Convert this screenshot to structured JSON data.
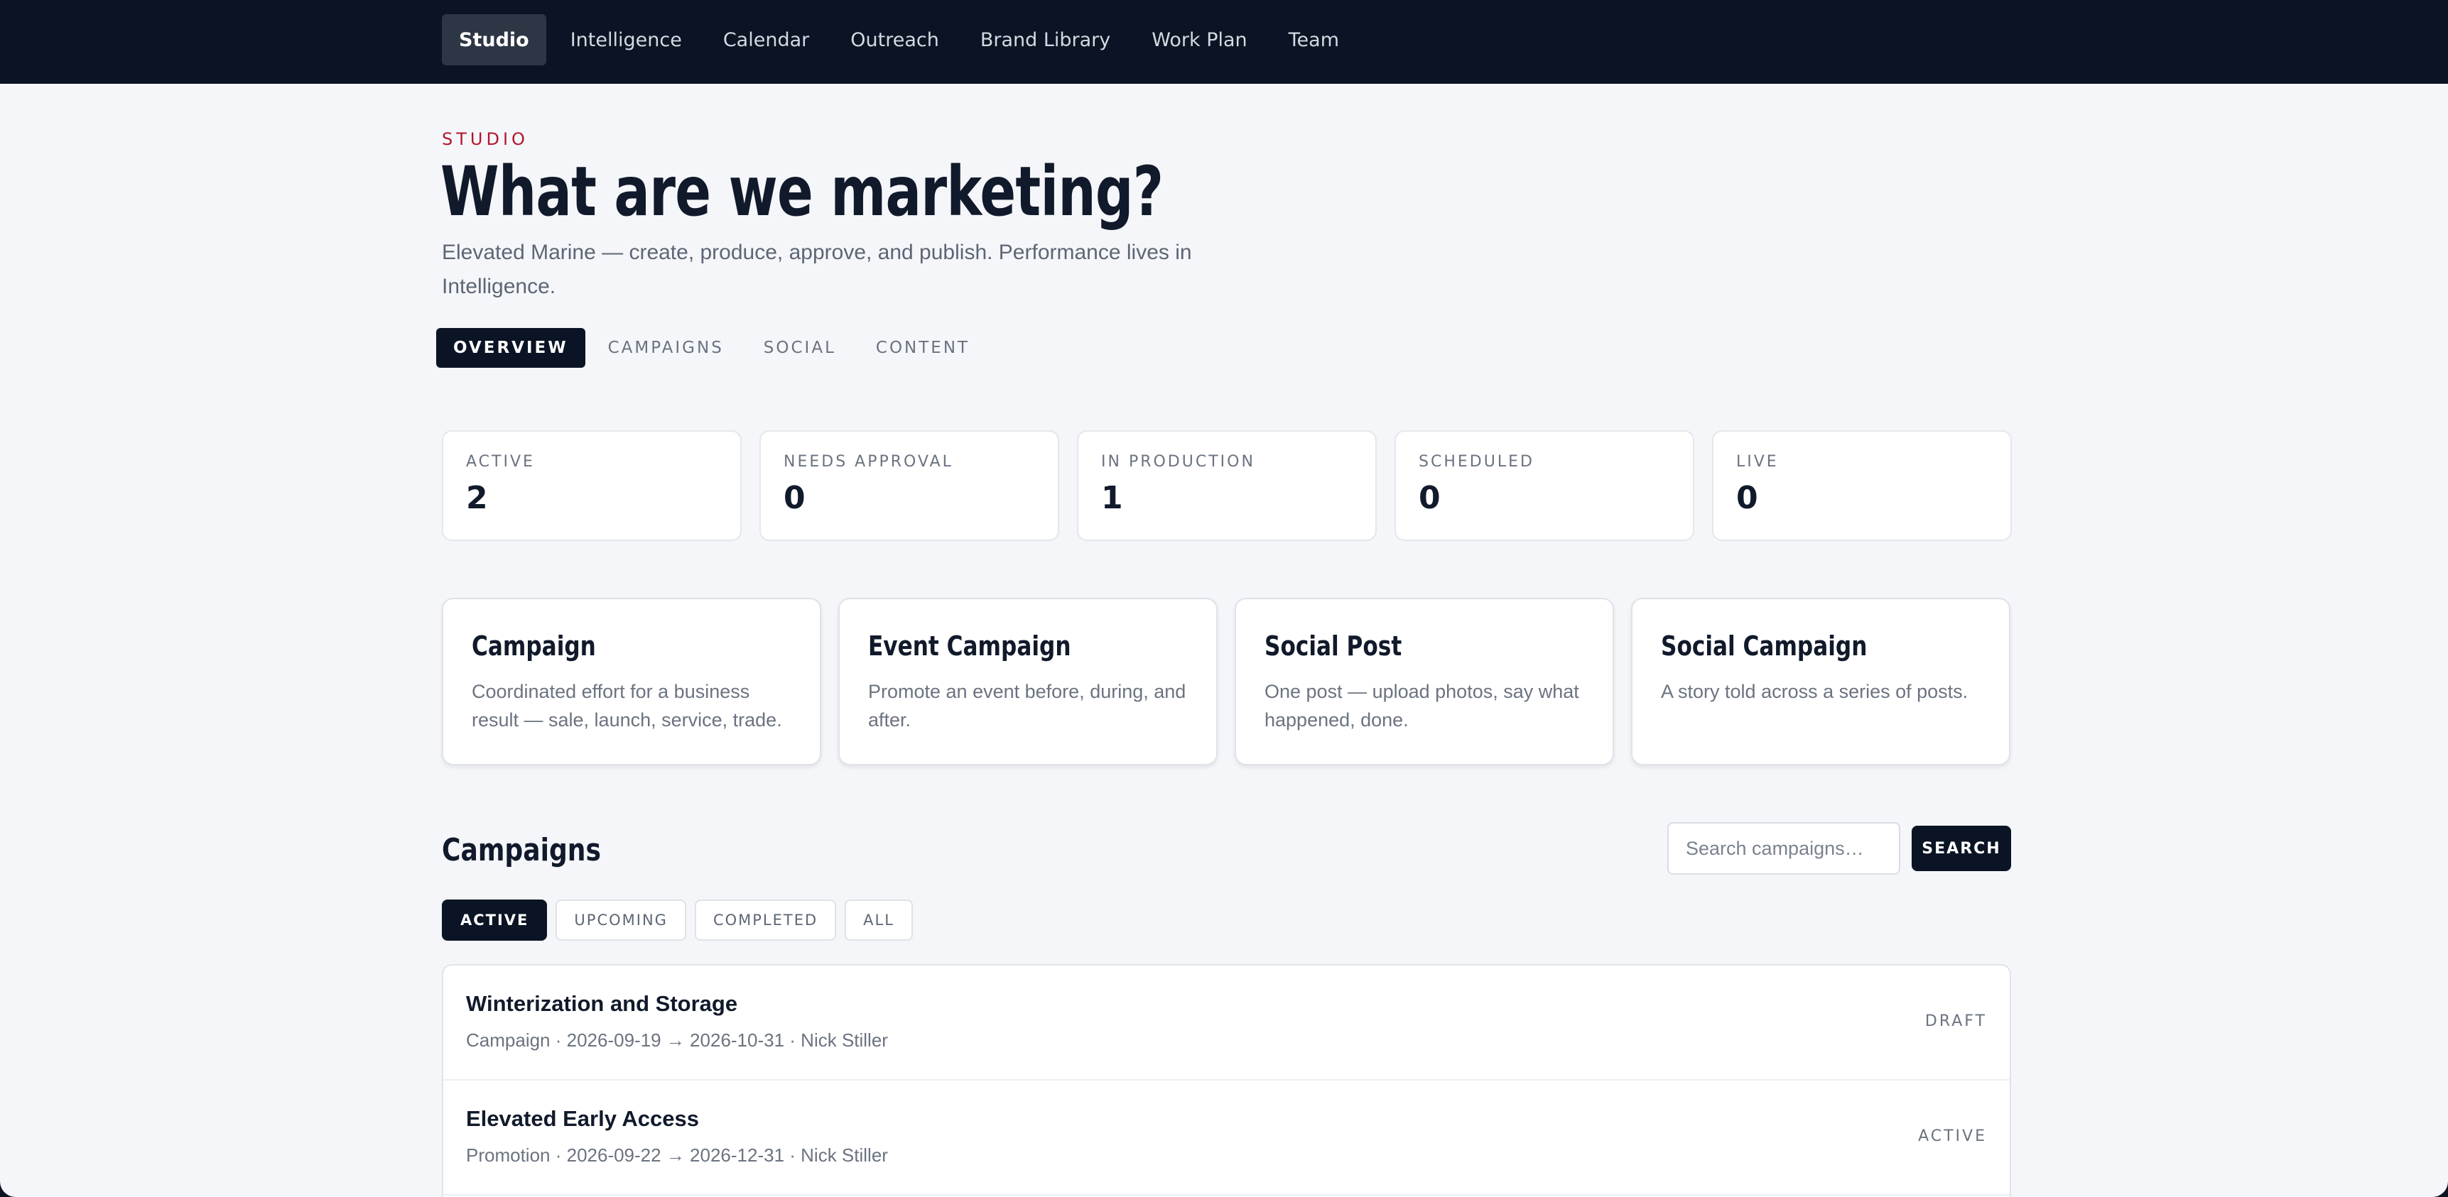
{
  "nav": {
    "items": [
      {
        "label": "Studio",
        "active": true
      },
      {
        "label": "Intelligence"
      },
      {
        "label": "Calendar"
      },
      {
        "label": "Outreach"
      },
      {
        "label": "Brand Library"
      },
      {
        "label": "Work Plan"
      },
      {
        "label": "Team"
      }
    ]
  },
  "header": {
    "eyebrow": "STUDIO",
    "title": "What are we marketing?",
    "subtitle": "Elevated Marine — create, produce, approve, and publish. Performance lives in Intelligence."
  },
  "tabs": [
    {
      "label": "OVERVIEW",
      "active": true
    },
    {
      "label": "CAMPAIGNS"
    },
    {
      "label": "SOCIAL"
    },
    {
      "label": "CONTENT"
    }
  ],
  "stats": [
    {
      "label": "ACTIVE",
      "value": "2"
    },
    {
      "label": "NEEDS APPROVAL",
      "value": "0"
    },
    {
      "label": "IN PRODUCTION",
      "value": "1"
    },
    {
      "label": "SCHEDULED",
      "value": "0"
    },
    {
      "label": "LIVE",
      "value": "0"
    }
  ],
  "types": [
    {
      "title": "Campaign",
      "desc": "Coordinated effort for a business result — sale, launch, service, trade."
    },
    {
      "title": "Event Campaign",
      "desc": "Promote an event before, during, and after."
    },
    {
      "title": "Social Post",
      "desc": "One post — upload photos, say what happened, done."
    },
    {
      "title": "Social Campaign",
      "desc": "A story told across a series of posts."
    }
  ],
  "campaigns": {
    "title": "Campaigns",
    "search": {
      "placeholder": "Search campaigns…",
      "button": "SEARCH"
    },
    "filters": [
      {
        "label": "ACTIVE",
        "active": true
      },
      {
        "label": "UPCOMING"
      },
      {
        "label": "COMPLETED"
      },
      {
        "label": "ALL"
      }
    ],
    "rows": [
      {
        "name": "Winterization and Storage",
        "meta": "Campaign · 2026-09-19 → 2026-10-31 · Nick Stiller",
        "status": "DRAFT"
      },
      {
        "name": "Elevated Early Access",
        "meta": "Promotion · 2026-09-22 → 2026-12-31 · Nick Stiller",
        "status": "ACTIVE"
      }
    ]
  }
}
